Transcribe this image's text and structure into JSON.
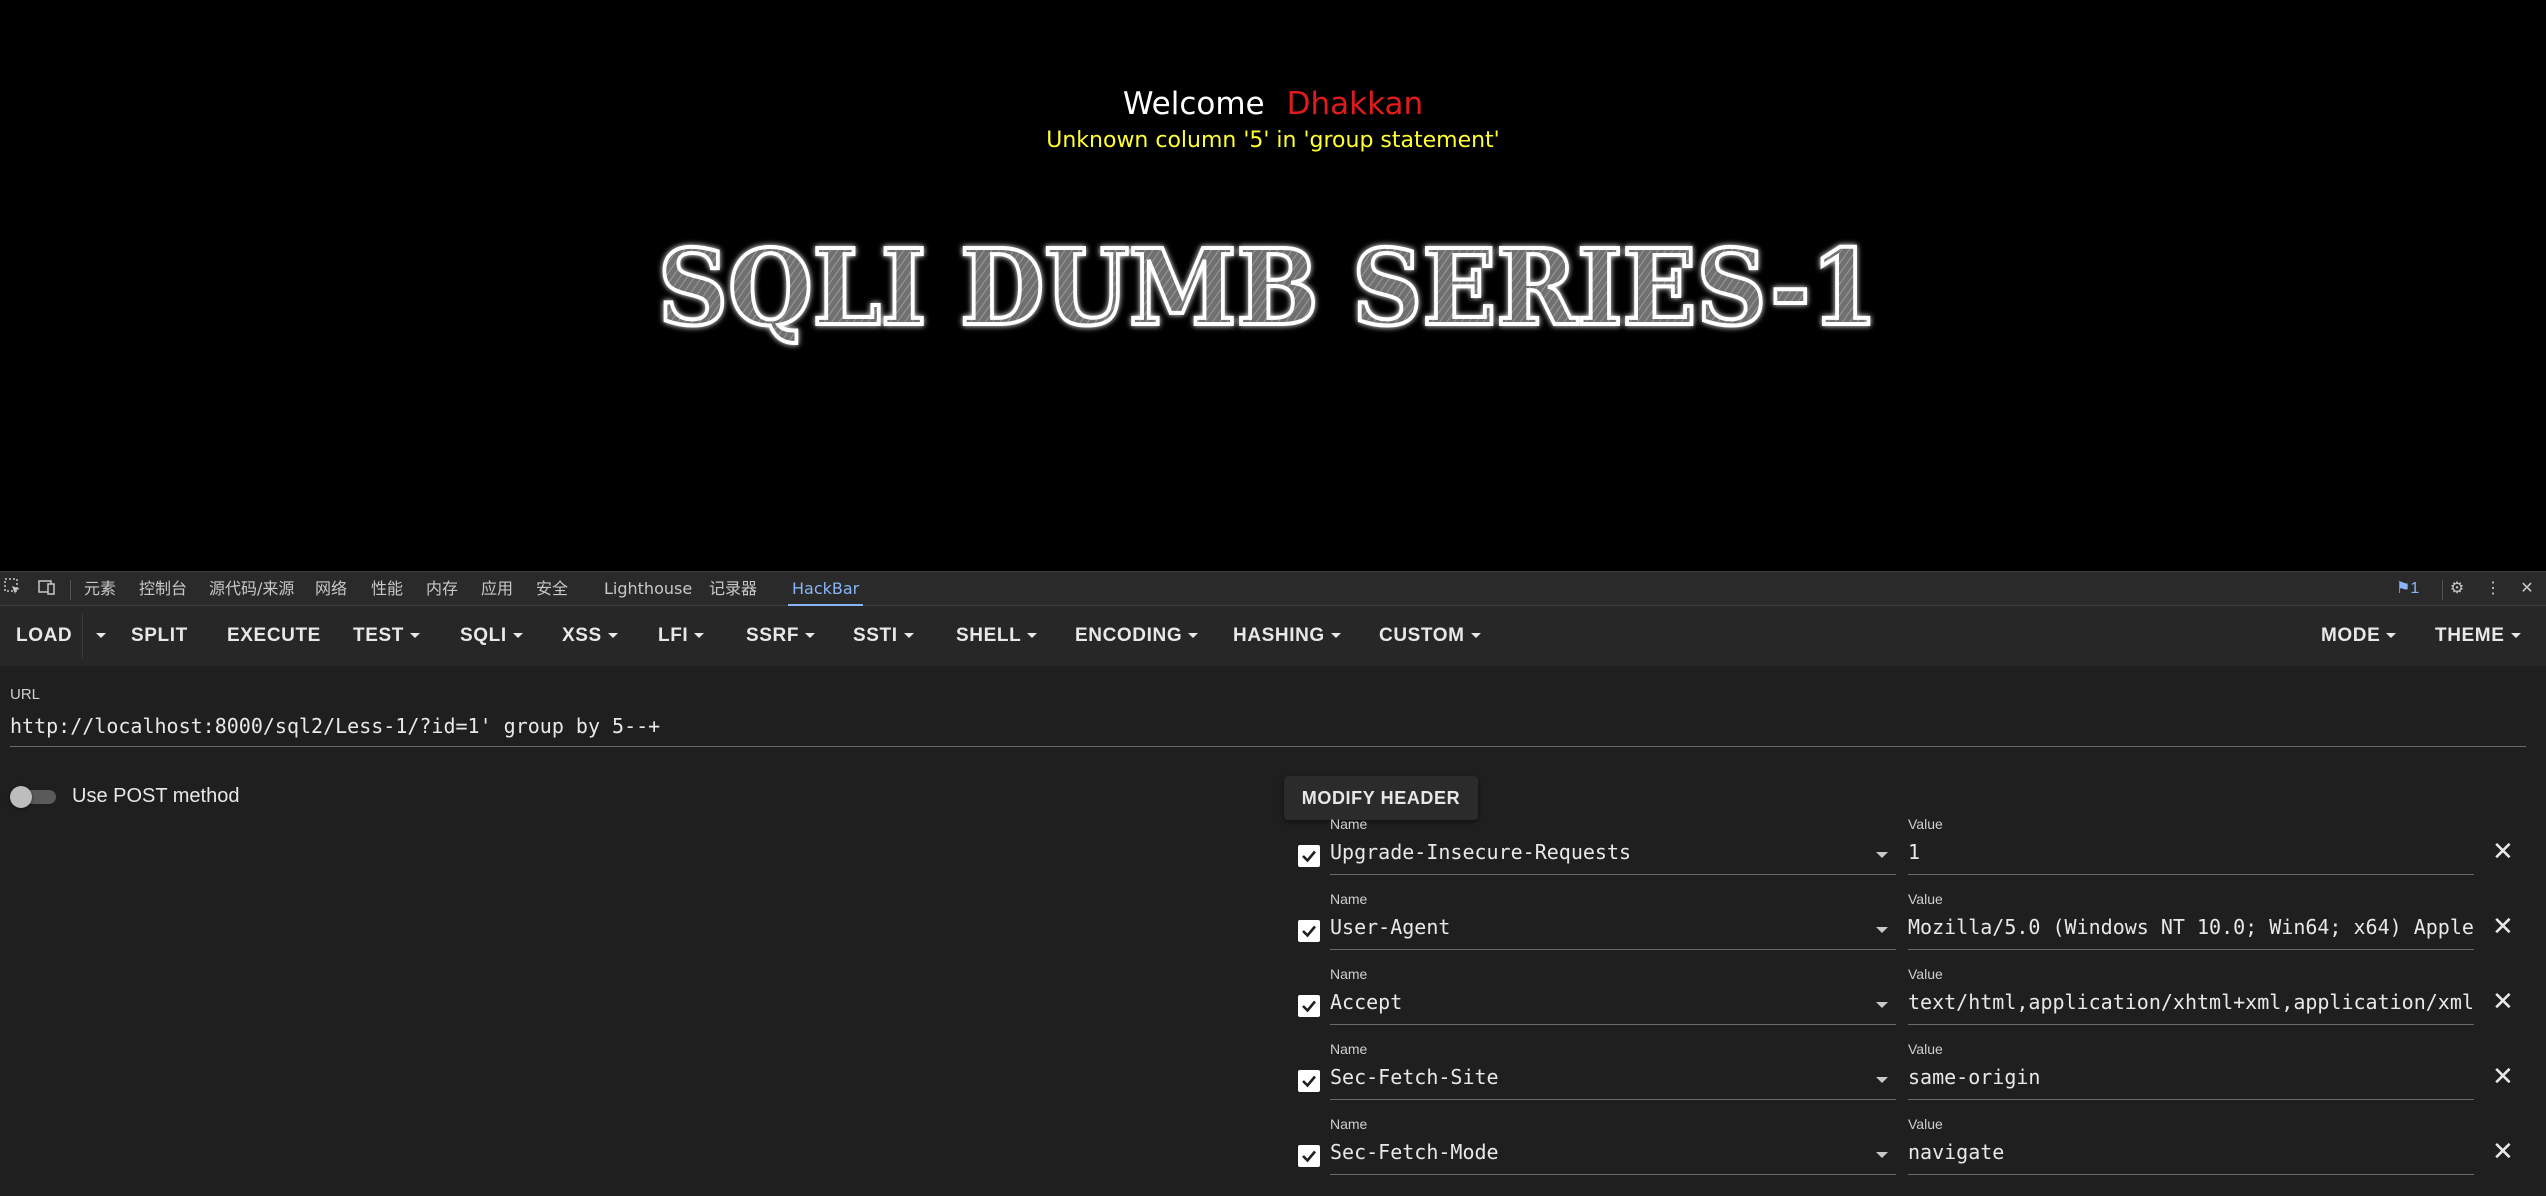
{
  "page": {
    "welcome": "Welcome",
    "username": "Dhakkan",
    "error": "Unknown column '5' in 'group statement'",
    "banner_text": "SQLI DUMB SERIES-1"
  },
  "devtools": {
    "tabs": [
      "元素",
      "控制台",
      "源代码/来源",
      "网络",
      "性能",
      "内存",
      "应用",
      "安全",
      "Lighthouse",
      "记录器",
      "HackBar"
    ],
    "active_tab": "HackBar",
    "issues_count": "1"
  },
  "hackbar": {
    "toolbar": {
      "load": "LOAD",
      "split": "SPLIT",
      "execute": "EXECUTE",
      "test": "TEST",
      "sqli": "SQLI",
      "xss": "XSS",
      "lfi": "LFI",
      "ssrf": "SSRF",
      "ssti": "SSTI",
      "shell": "SHELL",
      "encoding": "ENCODING",
      "hashing": "HASHING",
      "custom": "CUSTOM",
      "mode": "MODE",
      "theme": "THEME"
    },
    "url_label": "URL",
    "url": "http://localhost:8000/sql2/Less-1/?id=1' group by 5--+",
    "post_label": "Use POST method",
    "post_enabled": false,
    "modify_header": "MODIFY HEADER",
    "name_label": "Name",
    "value_label": "Value",
    "headers": [
      {
        "name": "Upgrade-Insecure-Requests",
        "value": "1",
        "enabled": true
      },
      {
        "name": "User-Agent",
        "value": "Mozilla/5.0 (Windows NT 10.0; Win64; x64) Apple",
        "enabled": true
      },
      {
        "name": "Accept",
        "value": "text/html,application/xhtml+xml,application/xml",
        "enabled": true
      },
      {
        "name": "Sec-Fetch-Site",
        "value": "same-origin",
        "enabled": true
      },
      {
        "name": "Sec-Fetch-Mode",
        "value": "navigate",
        "enabled": true
      }
    ]
  }
}
